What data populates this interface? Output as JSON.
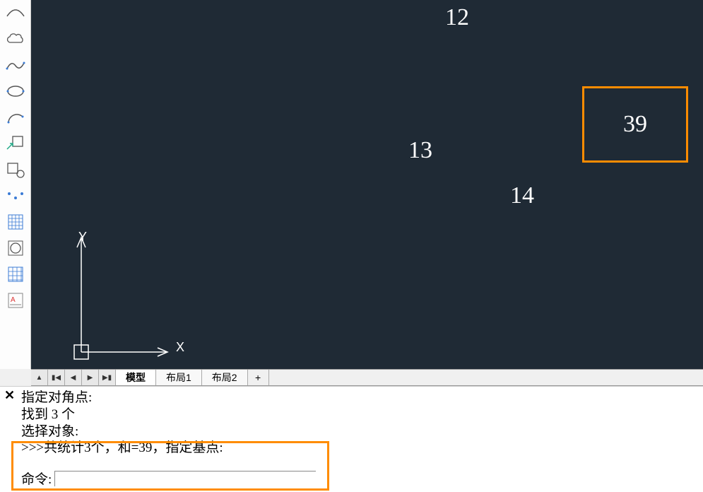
{
  "canvas": {
    "values": {
      "v12": "12",
      "v13": "13",
      "v14": "14"
    },
    "result": "39",
    "axis": {
      "x": "X",
      "y": "Y"
    }
  },
  "tabs": {
    "model": "模型",
    "layout1": "布局1",
    "layout2": "布局2",
    "add": "+"
  },
  "nav": {
    "up": "▲",
    "first": "▮◀",
    "prev": "◀",
    "next": "▶",
    "last": "▶▮"
  },
  "command": {
    "close": "✕",
    "line1": "指定对角点:",
    "line2": "找到 3 个",
    "line3": "选择对象:",
    "line4": ">>>共统计3个，和=39，指定基点:",
    "prompt": "命令:",
    "input_value": ""
  }
}
